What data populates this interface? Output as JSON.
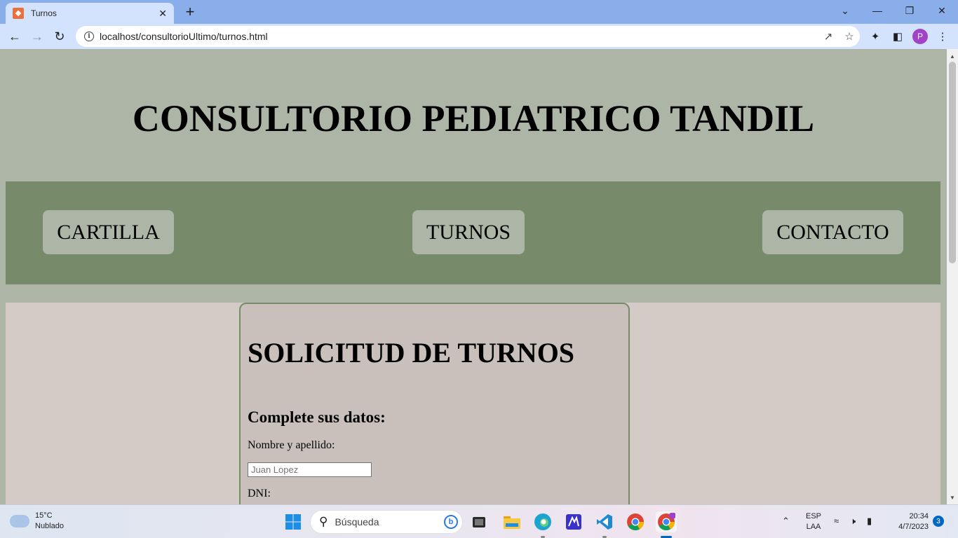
{
  "browser": {
    "tab_title": "Turnos",
    "tab_favicon": "xampp-icon",
    "url": "localhost/consultorioUltimo/turnos.html",
    "profile_initial": "P"
  },
  "page": {
    "site_title": "CONSULTORIO PEDIATRICO TANDIL",
    "nav": [
      {
        "label": "CARTILLA"
      },
      {
        "label": "TURNOS"
      },
      {
        "label": "CONTACTO"
      }
    ],
    "form": {
      "title": "SOLICITUD DE TURNOS",
      "subtitle": "Complete sus datos:",
      "name_label": "Nombre y apellido:",
      "name_placeholder": "Juan Lopez",
      "dni_label": "DNI:"
    },
    "colors": {
      "page_background": "#adb5a7",
      "nav_band": "#778a6a",
      "content_band": "#d4cbc7",
      "form_box": "#c9c0bb"
    }
  },
  "taskbar": {
    "weather_temp": "15°C",
    "weather_desc": "Nublado",
    "search_placeholder": "Búsqueda",
    "lang_top": "ESP",
    "lang_bottom": "LAA",
    "time": "20:34",
    "date": "4/7/2023",
    "notifications": "3"
  }
}
